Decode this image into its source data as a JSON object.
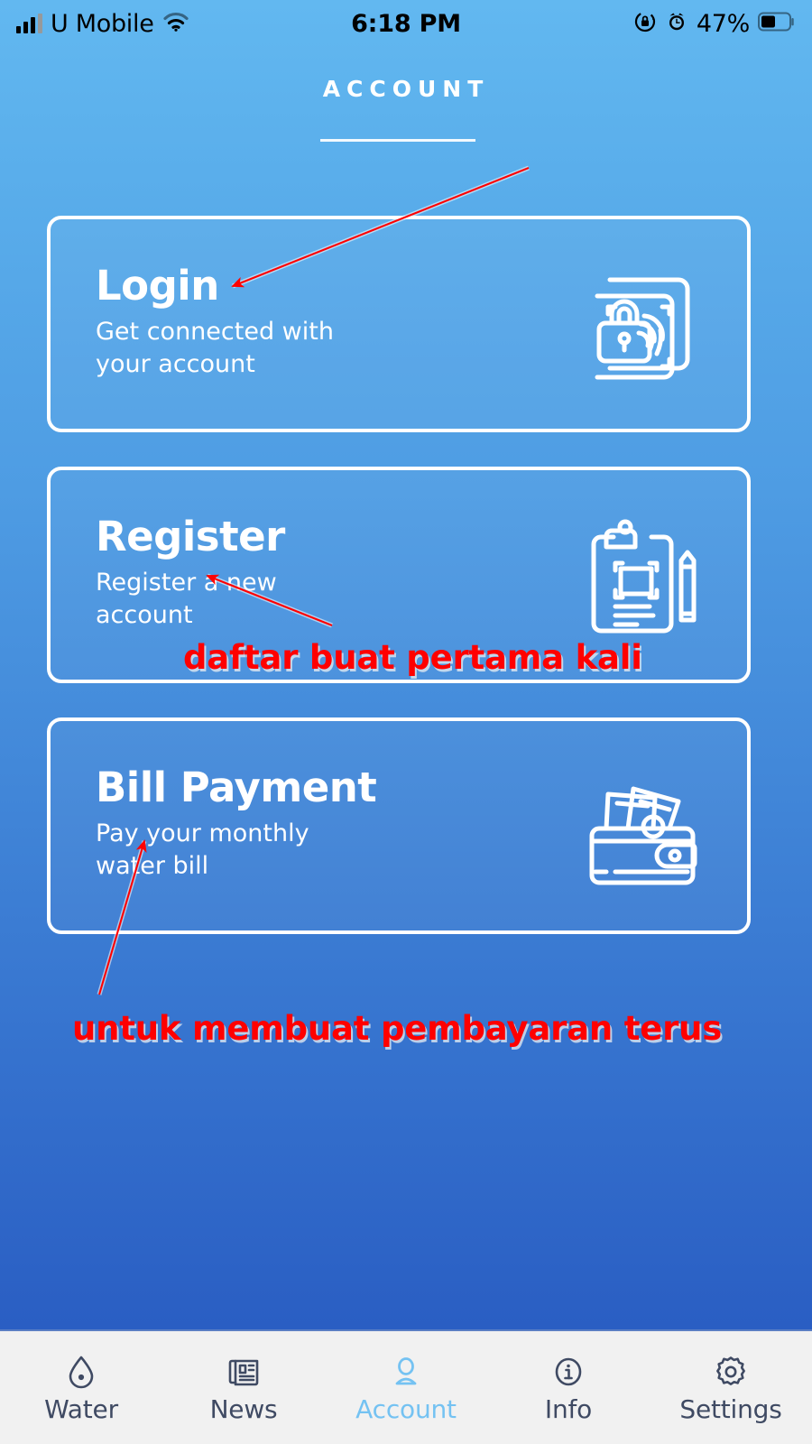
{
  "status_bar": {
    "carrier": "U Mobile",
    "signal_icon": "cellular-bars-icon",
    "wifi_icon": "wifi-icon",
    "time": "6:18 PM",
    "rotation_lock_icon": "rotation-lock-icon",
    "alarm_icon": "alarm-clock-icon",
    "battery_percent": "47%",
    "battery_icon": "battery-icon",
    "battery_level": 47
  },
  "header": {
    "title": "ACCOUNT"
  },
  "cards": [
    {
      "key": "login",
      "title": "Login",
      "subtitle": "Get connected with your account",
      "icon": "fingerprint-lock-scan-icon"
    },
    {
      "key": "register",
      "title": "Register",
      "subtitle": "Register a new account",
      "icon": "clipboard-pencil-icon"
    },
    {
      "key": "bill",
      "title": "Bill Payment",
      "subtitle": "Pay your monthly water bill",
      "icon": "wallet-cash-icon"
    }
  ],
  "annotations": [
    {
      "key": "login_arrow",
      "text": "",
      "color": "#ff0000",
      "target": "Login"
    },
    {
      "key": "register_note",
      "text": "daftar buat pertama kali",
      "color": "#ff0000",
      "target": "Register"
    },
    {
      "key": "bill_note",
      "text": "untuk membuat pembayaran terus",
      "color": "#ff0000",
      "target": "Bill Payment"
    }
  ],
  "tab_bar": {
    "active_index": 2,
    "active_color": "#74c2f2",
    "inactive_color": "#3f4a63",
    "background": "#f1f1f1",
    "items": [
      {
        "label": "Water",
        "icon": "water-drop-icon"
      },
      {
        "label": "News",
        "icon": "newspaper-icon"
      },
      {
        "label": "Account",
        "icon": "person-icon"
      },
      {
        "label": "Info",
        "icon": "info-circle-icon"
      },
      {
        "label": "Settings",
        "icon": "gear-icon"
      }
    ]
  },
  "theme": {
    "gradient_top": "#62b8f0",
    "gradient_bottom": "#2656bd",
    "card_border": "#ffffff",
    "text_color": "#ffffff",
    "annotation_color": "#ff0000"
  }
}
